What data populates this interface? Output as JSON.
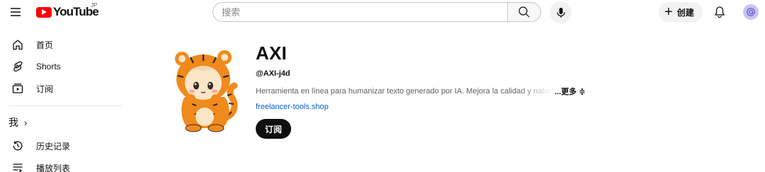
{
  "header": {
    "logo_text": "YouTube",
    "region": "JP",
    "search_placeholder": "搜索",
    "create_label": "创建",
    "avatar_letter": "a"
  },
  "sidebar": {
    "items": [
      {
        "label": "首页",
        "icon": "home-icon"
      },
      {
        "label": "Shorts",
        "icon": "shorts-icon"
      },
      {
        "label": "订阅",
        "icon": "subscriptions-icon"
      }
    ],
    "you_section": {
      "label": "我",
      "chevron": "›"
    },
    "you_items": [
      {
        "label": "历史记录",
        "icon": "history-icon"
      },
      {
        "label": "播放列表",
        "icon": "playlist-icon"
      }
    ]
  },
  "channel": {
    "name": "AXI",
    "handle": "@AXI-j4d",
    "description": "Herramienta en línea para humanizar texto generado por IA. Mejora la calidad y naturalidad",
    "more_label": "...更多 ≑",
    "link": "freelancer-tools.shop",
    "subscribe_label": "订阅"
  },
  "colors": {
    "brand_red": "#ff0000",
    "text_primary": "#0f0f0f",
    "text_secondary": "#606060",
    "link": "#065fd4",
    "avatar_bg": "#c9c4f0",
    "tiger_orange": "#f08a1c"
  }
}
